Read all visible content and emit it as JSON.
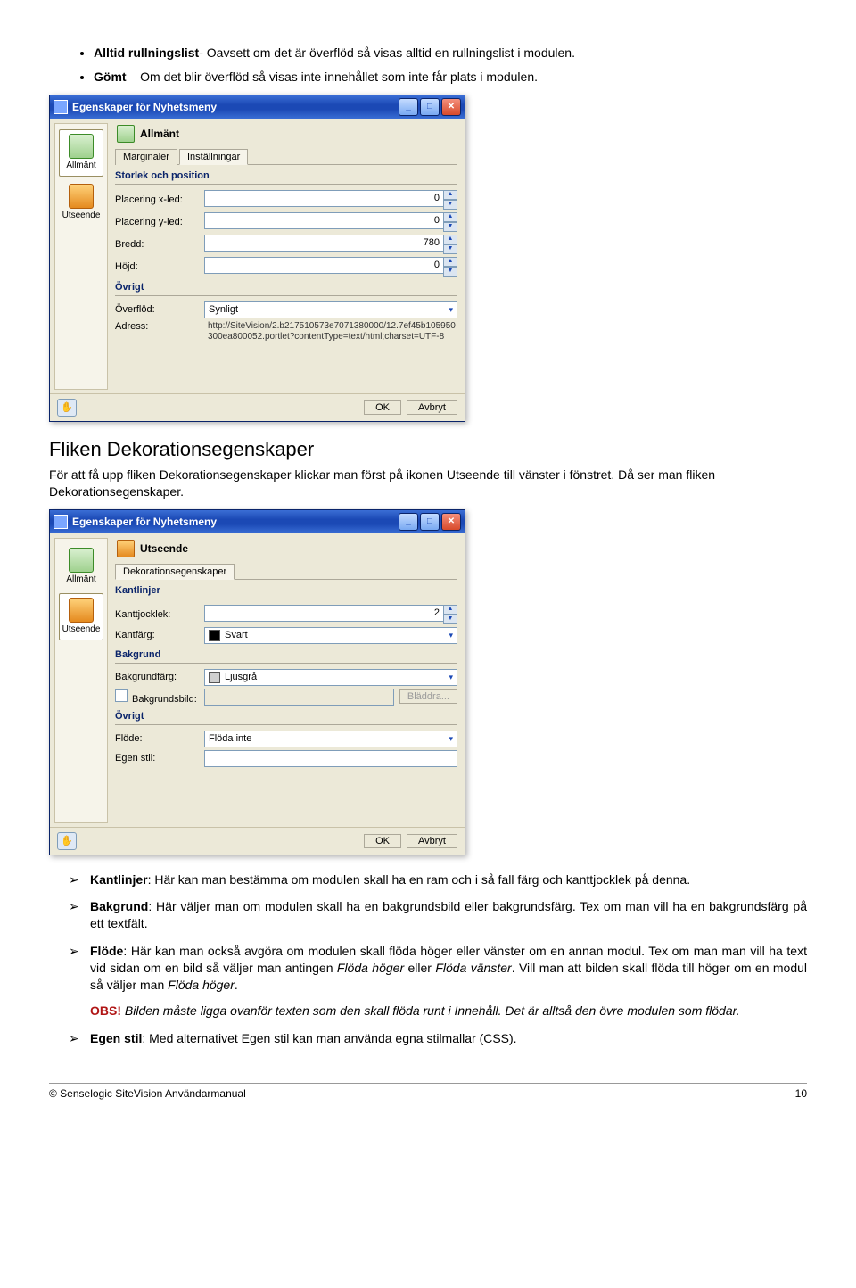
{
  "bullets": {
    "b1_strong": "Alltid rullningslist",
    "b1_text": "- Oavsett om det är överflöd så visas alltid en rullningslist i modulen.",
    "b2_strong": "Gömt",
    "b2_text": " – Om det blir överflöd så visas inte innehållet som inte får plats i modulen."
  },
  "dialog1": {
    "title": "Egenskaper för Nyhetsmeny",
    "sidebar": {
      "allmant": "Allmänt",
      "utseende": "Utseende"
    },
    "page_heading": "Allmänt",
    "tabs": {
      "marginaler": "Marginaler",
      "installningar": "Inställningar"
    },
    "group_size": "Storlek och position",
    "rows": {
      "placering_x_label": "Placering x-led:",
      "placering_x_value": "0",
      "placering_y_label": "Placering y-led:",
      "placering_y_value": "0",
      "bredd_label": "Bredd:",
      "bredd_value": "780",
      "hojd_label": "Höjd:",
      "hojd_value": "0"
    },
    "group_ovrigt": "Övrigt",
    "overflod_label": "Överflöd:",
    "overflod_value": "Synligt",
    "adress_label": "Adress:",
    "adress_value": "http://SiteVision/2.b217510573e7071380000/12.7ef45b105950300ea800052.portlet?contentType=text/html;charset=UTF-8",
    "buttons": {
      "ok": "OK",
      "cancel": "Avbryt"
    }
  },
  "section_heading": "Fliken Dekorationsegenskaper",
  "section_intro": "För att få upp fliken Dekorationsegenskaper klickar man först på ikonen Utseende till vänster i fönstret. Då ser man fliken Dekorationsegenskaper.",
  "dialog2": {
    "title": "Egenskaper för Nyhetsmeny",
    "sidebar": {
      "allmant": "Allmänt",
      "utseende": "Utseende"
    },
    "page_heading": "Utseende",
    "tab": "Dekorationsegenskaper",
    "group_kantlinjer": "Kantlinjer",
    "kantlinjer_tjocklek_label": "Kanttjocklek:",
    "kantlinjer_tjocklek_value": "2",
    "kantlinjer_farg_label": "Kantfärg:",
    "kantlinjer_farg_value": "Svart",
    "group_bakgrund": "Bakgrund",
    "bakgrund_farg_label": "Bakgrundfärg:",
    "bakgrund_farg_value": "Ljusgrå",
    "bakgrundsbild_label": "Bakgrundsbild:",
    "bladdra": "Bläddra...",
    "group_ovrigt": "Övrigt",
    "flode_label": "Flöde:",
    "flode_value": "Flöda inte",
    "egen_stil_label": "Egen stil:",
    "buttons": {
      "ok": "OK",
      "cancel": "Avbryt"
    }
  },
  "arrows": {
    "a1_strong": "Kantlinjer",
    "a1_text": ": Här kan man bestämma om modulen skall ha en ram och i så fall färg och kanttjocklek på denna.",
    "a2_strong": "Bakgrund",
    "a2_text": ": Här väljer man om modulen skall ha en bakgrundsbild eller bakgrundsfärg. Tex om man vill ha en bakgrundsfärg på ett textfält.",
    "a3_strong": "Flöde",
    "a3_text1": ": Här kan man också avgöra om modulen skall flöda höger eller vänster om en annan modul. Tex om man man vill ha text vid sidan om en bild så väljer man antingen ",
    "a3_i1": "Flöda höger",
    "a3_mid1": " eller ",
    "a3_i2": "Flöda vänster",
    "a3_mid2": ". Vill man att bilden skall flöda till höger om en modul så väljer man ",
    "a3_i3": "Flöda höger",
    "a3_end": ".",
    "obs_label": "OBS!",
    "obs_text": " Bilden måste ligga ovanför texten som den skall flöda runt i Innehåll. Det är alltså den övre modulen som flödar.",
    "a4_strong": "Egen stil",
    "a4_text": ": Med alternativet Egen stil kan man använda egna stilmallar (CSS)."
  },
  "footer": {
    "left": "© Senselogic SiteVision Användarmanual",
    "right": "10"
  }
}
